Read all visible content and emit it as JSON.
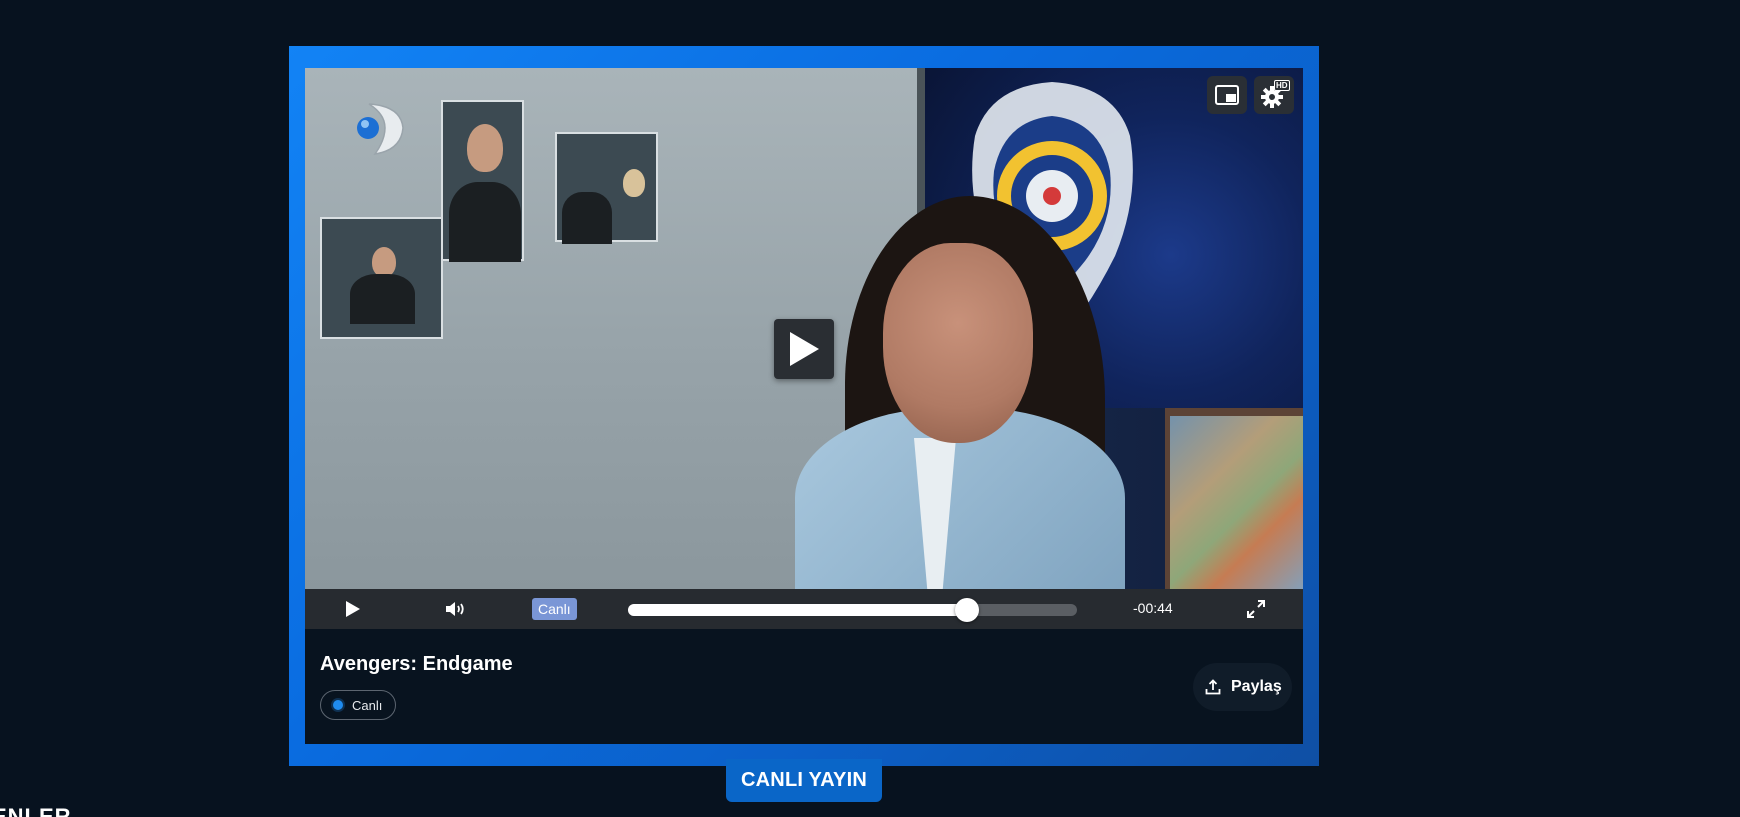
{
  "player": {
    "title": "Avengers: Endgame",
    "live_status": "Canlı",
    "live_tag": "Canlı",
    "time_remaining": "-00:44",
    "progress_percent": 75.5,
    "quality_badge": "HD",
    "share_label": "Paylaş",
    "icons": {
      "play": "play-icon",
      "volume": "volume-icon",
      "fullscreen": "fullscreen-icon",
      "pip": "picture-in-picture-icon",
      "settings": "gear-icon",
      "share": "share-icon"
    }
  },
  "banner": {
    "label": "CANLI YAYIN"
  },
  "section": {
    "heading": "ENLER"
  },
  "colors": {
    "background": "#07121f",
    "frame_accent": "#1283f5",
    "live_dot": "#1f8cf0",
    "banner": "#0a66c8"
  }
}
